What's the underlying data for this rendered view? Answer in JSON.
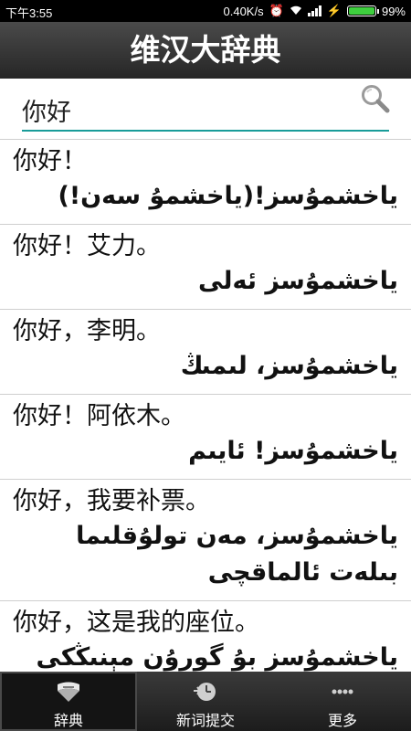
{
  "status": {
    "time": "下午3:55",
    "speed": "0.40K/s",
    "battery": "99%",
    "battery_level": 0.99
  },
  "header": {
    "title": "维汉大辞典"
  },
  "search": {
    "value": "你好"
  },
  "entries": [
    {
      "cn": "你好！",
      "ug": "ياخشمۇسز!(ياخشمۇ سەن!)"
    },
    {
      "cn": "你好！艾力。",
      "ug": "ياخشمۇسز ئەلى"
    },
    {
      "cn": "你好，李明。",
      "ug": "ياخشمۇسز، لىمىڭ"
    },
    {
      "cn": "你好！阿依木。",
      "ug": "ياخشمۇسز! ئايىم"
    },
    {
      "cn": "你好，我要补票。",
      "ug": "ياخشمۇسز، مەن تولۇقلىما بىلەت ئالماقچى"
    },
    {
      "cn": "你好，这是我的座位。",
      "ug": "ياخشمۇسز بۇ گورۇن مېنىڭكى"
    }
  ],
  "nav": {
    "tabs": [
      {
        "label": "辞典"
      },
      {
        "label": "新词提交"
      },
      {
        "label": "更多"
      }
    ]
  }
}
